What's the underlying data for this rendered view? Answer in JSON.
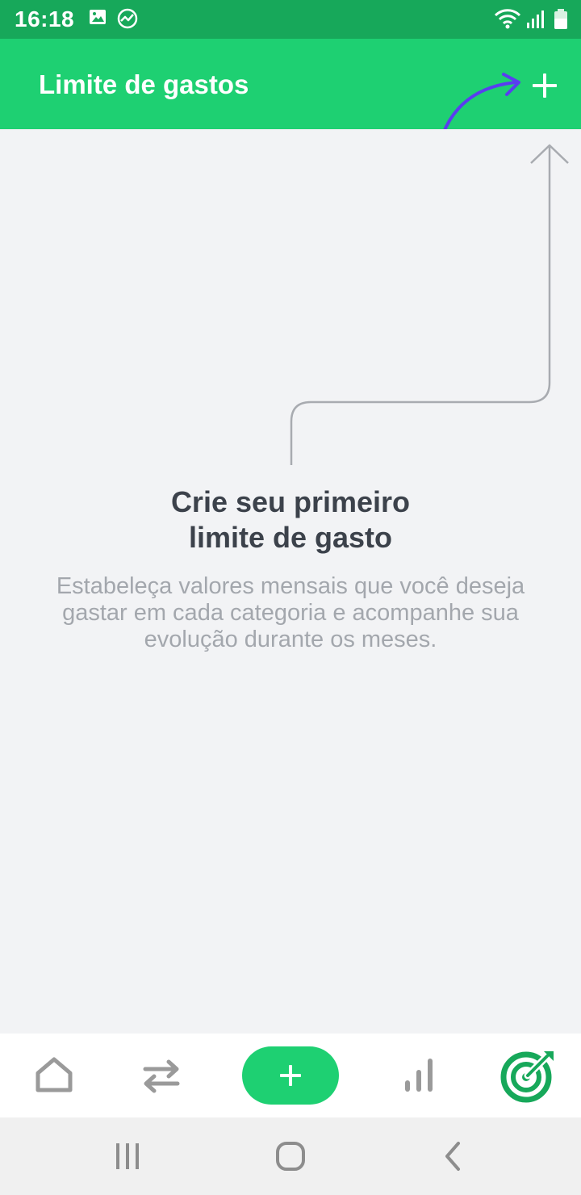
{
  "status_bar": {
    "time": "16:18",
    "left_icons": [
      "image-icon",
      "activity-chart-icon"
    ],
    "right_icons": [
      "wifi-icon",
      "signal-icon",
      "battery-icon"
    ]
  },
  "app_bar": {
    "title": "Limite de gastos",
    "action_icon": "plus-icon"
  },
  "empty_state": {
    "title": "Crie seu primeiro\nlimite de gasto",
    "description": "Estabeleça valores mensais que você deseja gastar em cada categoria e acompanhe sua evolução durante os meses."
  },
  "bottom_nav": {
    "items": [
      {
        "icon": "home-icon",
        "active": false
      },
      {
        "icon": "transfer-arrows-icon",
        "active": false
      },
      {
        "icon": "plus-icon",
        "active": false
      },
      {
        "icon": "bar-chart-icon",
        "active": false
      },
      {
        "icon": "target-icon",
        "active": true
      }
    ]
  },
  "system_nav": {
    "icons": [
      "recent-apps-icon",
      "home-circle-icon",
      "back-icon"
    ]
  },
  "colors": {
    "status_bar": "#17a85a",
    "brand_green": "#1ed072",
    "background": "#f2f3f5",
    "title_text": "#3c424b",
    "muted_text": "#a3a7ad",
    "annotation_arrow": "#5a3df0",
    "nav_icon": "#9a9a9a"
  }
}
